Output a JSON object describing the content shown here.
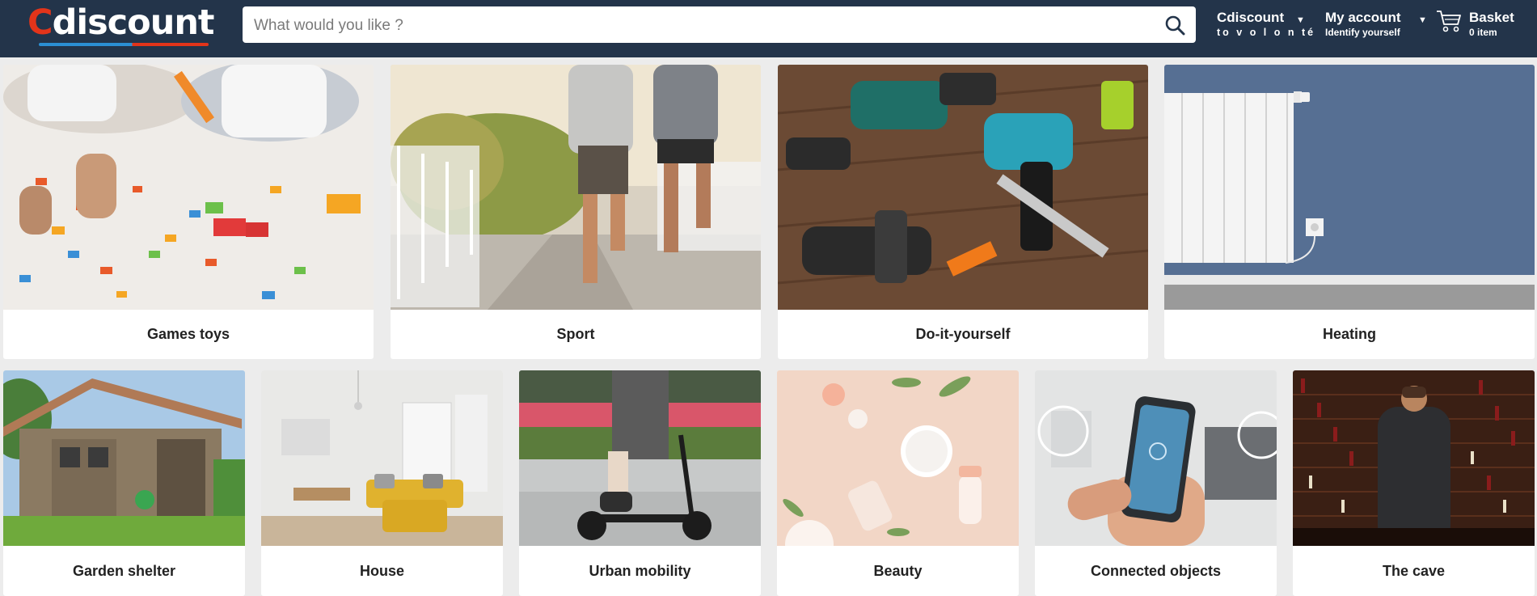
{
  "header": {
    "logo_text": "Cdiscount",
    "search": {
      "placeholder": "What would you like ?",
      "value": ""
    },
    "cdiscount_volonte": {
      "title": "Cdiscount",
      "subtitle": "to v o l o n té"
    },
    "account": {
      "title": "My account",
      "subtitle": "Identify yourself"
    },
    "basket": {
      "title": "Basket",
      "subtitle": "0 item"
    },
    "colors": {
      "bar": "#23344a",
      "logo_c": "#e3341a",
      "logo_blue": "#2b8fd4"
    }
  },
  "categories_row1": [
    {
      "label": "Games toys",
      "icon": "lego-bricks-image"
    },
    {
      "label": "Sport",
      "icon": "runners-image"
    },
    {
      "label": "Do-it-yourself",
      "icon": "power-tools-image"
    },
    {
      "label": "Heating",
      "icon": "radiator-image"
    }
  ],
  "categories_row2": [
    {
      "label": "Garden shelter",
      "icon": "garden-shed-image"
    },
    {
      "label": "House",
      "icon": "living-room-image"
    },
    {
      "label": "Urban mobility",
      "icon": "electric-scooter-image"
    },
    {
      "label": "Beauty",
      "icon": "cosmetics-image"
    },
    {
      "label": "Connected objects",
      "icon": "smart-home-phone-image"
    },
    {
      "label": "The cave",
      "icon": "wine-cellar-image"
    }
  ]
}
